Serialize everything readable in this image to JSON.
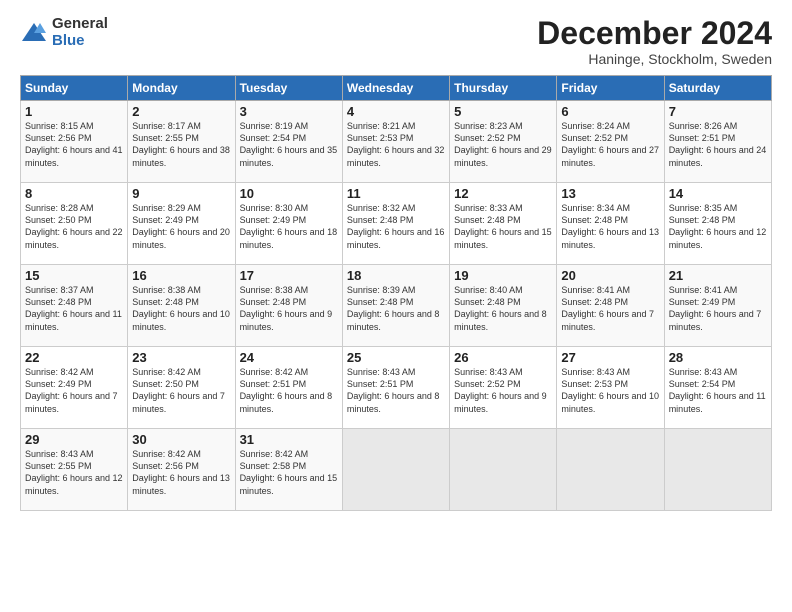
{
  "logo": {
    "general": "General",
    "blue": "Blue"
  },
  "title": {
    "main": "December 2024",
    "sub": "Haninge, Stockholm, Sweden"
  },
  "weekdays": [
    "Sunday",
    "Monday",
    "Tuesday",
    "Wednesday",
    "Thursday",
    "Friday",
    "Saturday"
  ],
  "weeks": [
    [
      {
        "day": "1",
        "sunrise": "Sunrise: 8:15 AM",
        "sunset": "Sunset: 2:56 PM",
        "daylight": "Daylight: 6 hours and 41 minutes."
      },
      {
        "day": "2",
        "sunrise": "Sunrise: 8:17 AM",
        "sunset": "Sunset: 2:55 PM",
        "daylight": "Daylight: 6 hours and 38 minutes."
      },
      {
        "day": "3",
        "sunrise": "Sunrise: 8:19 AM",
        "sunset": "Sunset: 2:54 PM",
        "daylight": "Daylight: 6 hours and 35 minutes."
      },
      {
        "day": "4",
        "sunrise": "Sunrise: 8:21 AM",
        "sunset": "Sunset: 2:53 PM",
        "daylight": "Daylight: 6 hours and 32 minutes."
      },
      {
        "day": "5",
        "sunrise": "Sunrise: 8:23 AM",
        "sunset": "Sunset: 2:52 PM",
        "daylight": "Daylight: 6 hours and 29 minutes."
      },
      {
        "day": "6",
        "sunrise": "Sunrise: 8:24 AM",
        "sunset": "Sunset: 2:52 PM",
        "daylight": "Daylight: 6 hours and 27 minutes."
      },
      {
        "day": "7",
        "sunrise": "Sunrise: 8:26 AM",
        "sunset": "Sunset: 2:51 PM",
        "daylight": "Daylight: 6 hours and 24 minutes."
      }
    ],
    [
      {
        "day": "8",
        "sunrise": "Sunrise: 8:28 AM",
        "sunset": "Sunset: 2:50 PM",
        "daylight": "Daylight: 6 hours and 22 minutes."
      },
      {
        "day": "9",
        "sunrise": "Sunrise: 8:29 AM",
        "sunset": "Sunset: 2:49 PM",
        "daylight": "Daylight: 6 hours and 20 minutes."
      },
      {
        "day": "10",
        "sunrise": "Sunrise: 8:30 AM",
        "sunset": "Sunset: 2:49 PM",
        "daylight": "Daylight: 6 hours and 18 minutes."
      },
      {
        "day": "11",
        "sunrise": "Sunrise: 8:32 AM",
        "sunset": "Sunset: 2:48 PM",
        "daylight": "Daylight: 6 hours and 16 minutes."
      },
      {
        "day": "12",
        "sunrise": "Sunrise: 8:33 AM",
        "sunset": "Sunset: 2:48 PM",
        "daylight": "Daylight: 6 hours and 15 minutes."
      },
      {
        "day": "13",
        "sunrise": "Sunrise: 8:34 AM",
        "sunset": "Sunset: 2:48 PM",
        "daylight": "Daylight: 6 hours and 13 minutes."
      },
      {
        "day": "14",
        "sunrise": "Sunrise: 8:35 AM",
        "sunset": "Sunset: 2:48 PM",
        "daylight": "Daylight: 6 hours and 12 minutes."
      }
    ],
    [
      {
        "day": "15",
        "sunrise": "Sunrise: 8:37 AM",
        "sunset": "Sunset: 2:48 PM",
        "daylight": "Daylight: 6 hours and 11 minutes."
      },
      {
        "day": "16",
        "sunrise": "Sunrise: 8:38 AM",
        "sunset": "Sunset: 2:48 PM",
        "daylight": "Daylight: 6 hours and 10 minutes."
      },
      {
        "day": "17",
        "sunrise": "Sunrise: 8:38 AM",
        "sunset": "Sunset: 2:48 PM",
        "daylight": "Daylight: 6 hours and 9 minutes."
      },
      {
        "day": "18",
        "sunrise": "Sunrise: 8:39 AM",
        "sunset": "Sunset: 2:48 PM",
        "daylight": "Daylight: 6 hours and 8 minutes."
      },
      {
        "day": "19",
        "sunrise": "Sunrise: 8:40 AM",
        "sunset": "Sunset: 2:48 PM",
        "daylight": "Daylight: 6 hours and 8 minutes."
      },
      {
        "day": "20",
        "sunrise": "Sunrise: 8:41 AM",
        "sunset": "Sunset: 2:48 PM",
        "daylight": "Daylight: 6 hours and 7 minutes."
      },
      {
        "day": "21",
        "sunrise": "Sunrise: 8:41 AM",
        "sunset": "Sunset: 2:49 PM",
        "daylight": "Daylight: 6 hours and 7 minutes."
      }
    ],
    [
      {
        "day": "22",
        "sunrise": "Sunrise: 8:42 AM",
        "sunset": "Sunset: 2:49 PM",
        "daylight": "Daylight: 6 hours and 7 minutes."
      },
      {
        "day": "23",
        "sunrise": "Sunrise: 8:42 AM",
        "sunset": "Sunset: 2:50 PM",
        "daylight": "Daylight: 6 hours and 7 minutes."
      },
      {
        "day": "24",
        "sunrise": "Sunrise: 8:42 AM",
        "sunset": "Sunset: 2:51 PM",
        "daylight": "Daylight: 6 hours and 8 minutes."
      },
      {
        "day": "25",
        "sunrise": "Sunrise: 8:43 AM",
        "sunset": "Sunset: 2:51 PM",
        "daylight": "Daylight: 6 hours and 8 minutes."
      },
      {
        "day": "26",
        "sunrise": "Sunrise: 8:43 AM",
        "sunset": "Sunset: 2:52 PM",
        "daylight": "Daylight: 6 hours and 9 minutes."
      },
      {
        "day": "27",
        "sunrise": "Sunrise: 8:43 AM",
        "sunset": "Sunset: 2:53 PM",
        "daylight": "Daylight: 6 hours and 10 minutes."
      },
      {
        "day": "28",
        "sunrise": "Sunrise: 8:43 AM",
        "sunset": "Sunset: 2:54 PM",
        "daylight": "Daylight: 6 hours and 11 minutes."
      }
    ],
    [
      {
        "day": "29",
        "sunrise": "Sunrise: 8:43 AM",
        "sunset": "Sunset: 2:55 PM",
        "daylight": "Daylight: 6 hours and 12 minutes."
      },
      {
        "day": "30",
        "sunrise": "Sunrise: 8:42 AM",
        "sunset": "Sunset: 2:56 PM",
        "daylight": "Daylight: 6 hours and 13 minutes."
      },
      {
        "day": "31",
        "sunrise": "Sunrise: 8:42 AM",
        "sunset": "Sunset: 2:58 PM",
        "daylight": "Daylight: 6 hours and 15 minutes."
      },
      null,
      null,
      null,
      null
    ]
  ]
}
